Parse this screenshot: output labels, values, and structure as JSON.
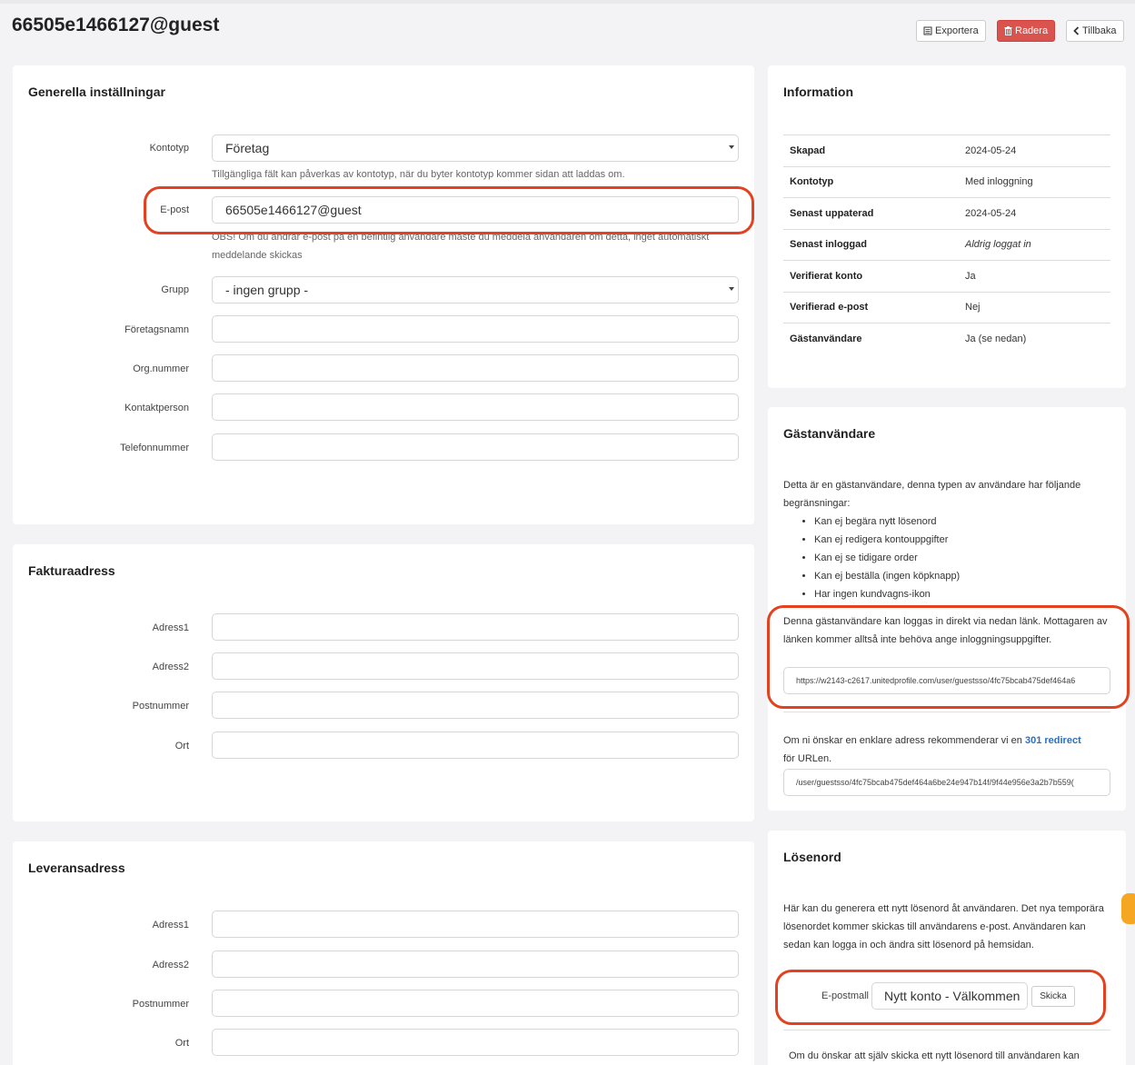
{
  "header": {
    "title": "66505e1466127@guest",
    "export_label": "Exportera",
    "delete_label": "Radera",
    "back_label": "Tillbaka"
  },
  "general": {
    "title": "Generella inställningar",
    "account_type_label": "Kontotyp",
    "account_type_value": "Företag",
    "account_type_help": "Tillgängliga fält kan påverkas av kontotyp, när du byter kontotyp kommer sidan att laddas om.",
    "email_label": "E-post",
    "email_value": "66505e1466127@guest",
    "email_help": "OBS! Om du ändrar e-post på en befintlig användare måste du meddela användaren om detta, inget automatiskt meddelande skickas",
    "group_label": "Grupp",
    "group_value": "- ingen grupp -",
    "company_label": "Företagsnamn",
    "org_label": "Org.nummer",
    "contact_label": "Kontaktperson",
    "phone_label": "Telefonnummer"
  },
  "billing": {
    "title": "Fakturaadress",
    "address1_label": "Adress1",
    "address2_label": "Adress2",
    "zip_label": "Postnummer",
    "city_label": "Ort"
  },
  "delivery": {
    "title": "Leveransadress",
    "address1_label": "Adress1",
    "address2_label": "Adress2",
    "zip_label": "Postnummer",
    "city_label": "Ort"
  },
  "info": {
    "title": "Information",
    "rows": [
      {
        "key": "Skapad",
        "value": "2024-05-24"
      },
      {
        "key": "Kontotyp",
        "value": "Med inloggning"
      },
      {
        "key": "Senast uppaterad",
        "value": "2024-05-24"
      },
      {
        "key": "Senast inloggad",
        "value": "Aldrig loggat in"
      },
      {
        "key": "Verifierat konto",
        "value": "Ja"
      },
      {
        "key": "Verifierad e-post",
        "value": "Nej"
      },
      {
        "key": "Gästanvändare",
        "value": "Ja (se nedan)"
      }
    ]
  },
  "guest": {
    "title": "Gästanvändare",
    "intro": "Detta är en gästanvändare, denna typen av användare har följande begränsningar:",
    "restrictions": [
      "Kan ej begära nytt lösenord",
      "Kan ej redigera kontouppgifter",
      "Kan ej se tidigare order",
      "Kan ej beställa (ingen köpknapp)",
      "Har ingen kundvagns-ikon"
    ],
    "login_text": "Denna gästanvändare kan loggas in direkt via nedan länk. Mottagaren av länken kommer alltså inte behöva ange inloggningsuppgifter.",
    "login_url": "https://w2143-c2617.unitedprofile.com/user/guestsso/4fc75bcab475def464a6",
    "redirect_text_before": "Om ni önskar en enklare adress rekommenderar vi en",
    "redirect_link": "301 redirect",
    "redirect_text_after": "för URLen.",
    "redirect_path": "/user/guestsso/4fc75bcab475def464a6be24e947b14f/9f44e956e3a2b7b559("
  },
  "password": {
    "title": "Lösenord",
    "description": "Här kan du generera ett nytt lösenord åt användaren. Det nya temporära lösenordet kommer skickas till användarens e-post. Användaren kan sedan kan logga in och ändra sitt lösenord på hemsidan.",
    "template_label": "E-postmall",
    "template_value": "Nytt konto - Välkommen",
    "send_label": "Skicka",
    "footer_text": "Om du önskar att själv skicka ett nytt lösenord till användaren kan"
  }
}
